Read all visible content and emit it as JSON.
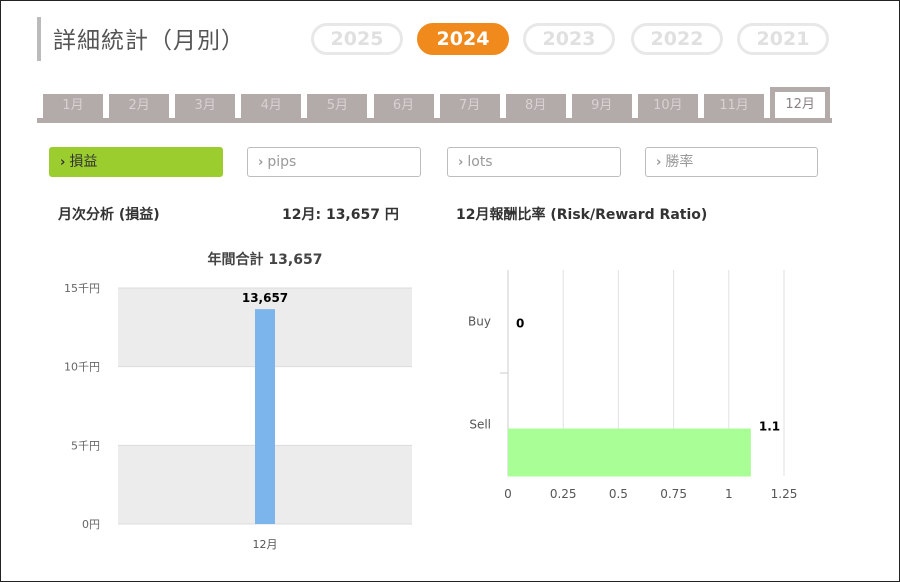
{
  "page_title": "詳細統計（月別）",
  "years": [
    {
      "label": "2025",
      "active": false
    },
    {
      "label": "2024",
      "active": true
    },
    {
      "label": "2023",
      "active": false
    },
    {
      "label": "2022",
      "active": false
    },
    {
      "label": "2021",
      "active": false
    }
  ],
  "months": [
    "1月",
    "2月",
    "3月",
    "4月",
    "5月",
    "6月",
    "7月",
    "8月",
    "9月",
    "10月",
    "11月",
    "12月"
  ],
  "active_month": "12月",
  "metrics": [
    {
      "label": "損益",
      "active": true
    },
    {
      "label": "pips",
      "active": false
    },
    {
      "label": "lots",
      "active": false
    },
    {
      "label": "勝率",
      "active": false
    }
  ],
  "colors": {
    "accent_orange": "#f08a1d",
    "accent_green": "#9bcd2e",
    "bar_blue": "#7cb5ec",
    "bar_green": "#a9ff96"
  },
  "monthly_analysis_label": "月次分析 (損益)",
  "month_total_label": "12月:  13,657 円",
  "ratio_label": "12月報酬比率 (Risk/Reward Ratio)",
  "chart_data": [
    {
      "type": "bar",
      "title": "年間合計 13,657",
      "categories": [
        "12月"
      ],
      "values": [
        13657
      ],
      "data_labels": [
        "13,657"
      ],
      "y_ticks": [
        "0円",
        "5千円",
        "10千円",
        "15千円"
      ],
      "ylim": [
        0,
        15000
      ],
      "grid": true
    },
    {
      "type": "bar",
      "orientation": "horizontal",
      "categories": [
        "Buy",
        "Sell"
      ],
      "values": [
        0,
        1.1
      ],
      "data_labels": [
        "0",
        "1.1"
      ],
      "x_ticks": [
        "0",
        "0.25",
        "0.5",
        "0.75",
        "1",
        "1.25"
      ],
      "xlim": [
        0,
        1.25
      ],
      "grid": true
    }
  ]
}
